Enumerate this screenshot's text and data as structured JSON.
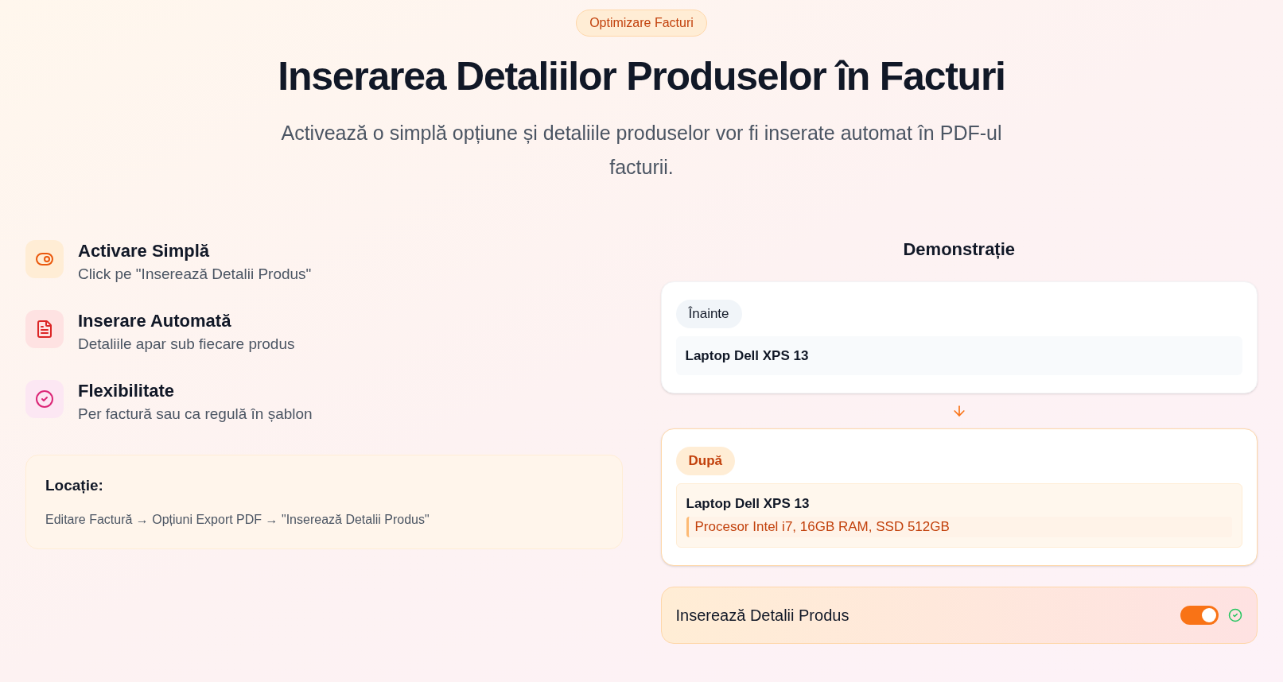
{
  "badge": "Optimizare Facturi",
  "title": "Inserarea Detaliilor Produselor în Facturi",
  "subtitle": "Activează o simplă opțiune și detaliile produselor vor fi inserate automat în PDF-ul facturii.",
  "features": [
    {
      "kind": "toggle",
      "title": "Activare Simplă",
      "description": "Click pe \"Inserează Detalii Produs\""
    },
    {
      "kind": "document",
      "title": "Inserare Automată",
      "description": "Detaliile apar sub fiecare produs"
    },
    {
      "kind": "check",
      "title": "Flexibilitate",
      "description": "Per factură sau ca regulă în șablon"
    }
  ],
  "location": {
    "title": "Locație:",
    "path": "Editare Factură → Opțiuni Export PDF → \"Inserează Detalii Produs\""
  },
  "demo": {
    "heading": "Demonstrație",
    "before": {
      "label": "Înainte",
      "product": "Laptop Dell XPS 13"
    },
    "after": {
      "label": "După",
      "product": "Laptop Dell XPS 13",
      "details": "Procesor Intel i7, 16GB RAM, SSD 512GB"
    },
    "toggle": {
      "label": "Inserează Detalii Produs",
      "on": true
    }
  }
}
